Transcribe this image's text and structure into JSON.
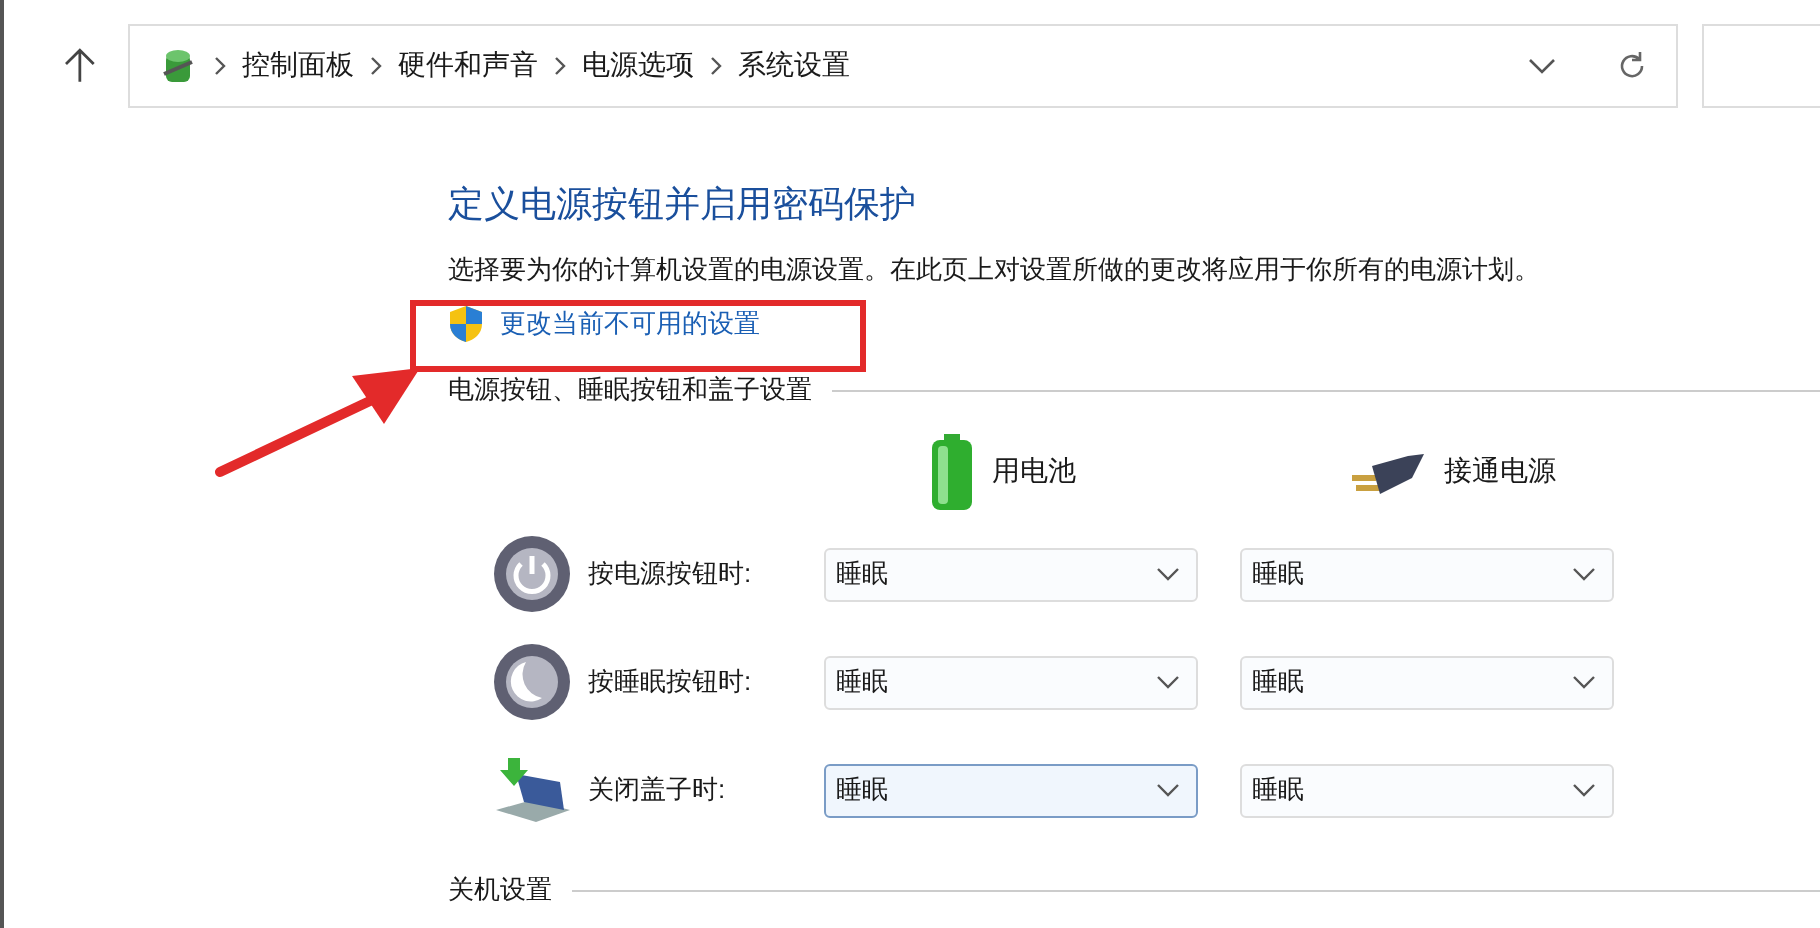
{
  "breadcrumb": [
    "控制面板",
    "硬件和声音",
    "电源选项",
    "系统设置"
  ],
  "title": "定义电源按钮并启用密码保护",
  "description": "选择要为你的计算机设置的电源设置。在此页上对设置所做的更改将应用于你所有的电源计划。",
  "admin_link": "更改当前不可用的设置",
  "section": "电源按钮、睡眠按钮和盖子设置",
  "columns": [
    {
      "kind": "battery",
      "label": "用电池"
    },
    {
      "kind": "plug",
      "label": "接通电源"
    }
  ],
  "rows": [
    {
      "kind": "power",
      "label": "按电源按钮时:",
      "values": [
        {
          "value": "睡眠",
          "focused": false
        },
        {
          "value": "睡眠",
          "focused": false
        }
      ]
    },
    {
      "kind": "sleep",
      "label": "按睡眠按钮时:",
      "values": [
        {
          "value": "睡眠",
          "focused": false
        },
        {
          "value": "睡眠",
          "focused": false
        }
      ]
    },
    {
      "kind": "lid",
      "label": "关闭盖子时:",
      "values": [
        {
          "value": "睡眠",
          "focused": true
        },
        {
          "value": "睡眠",
          "focused": false
        }
      ]
    }
  ],
  "next_section": "关机设置"
}
